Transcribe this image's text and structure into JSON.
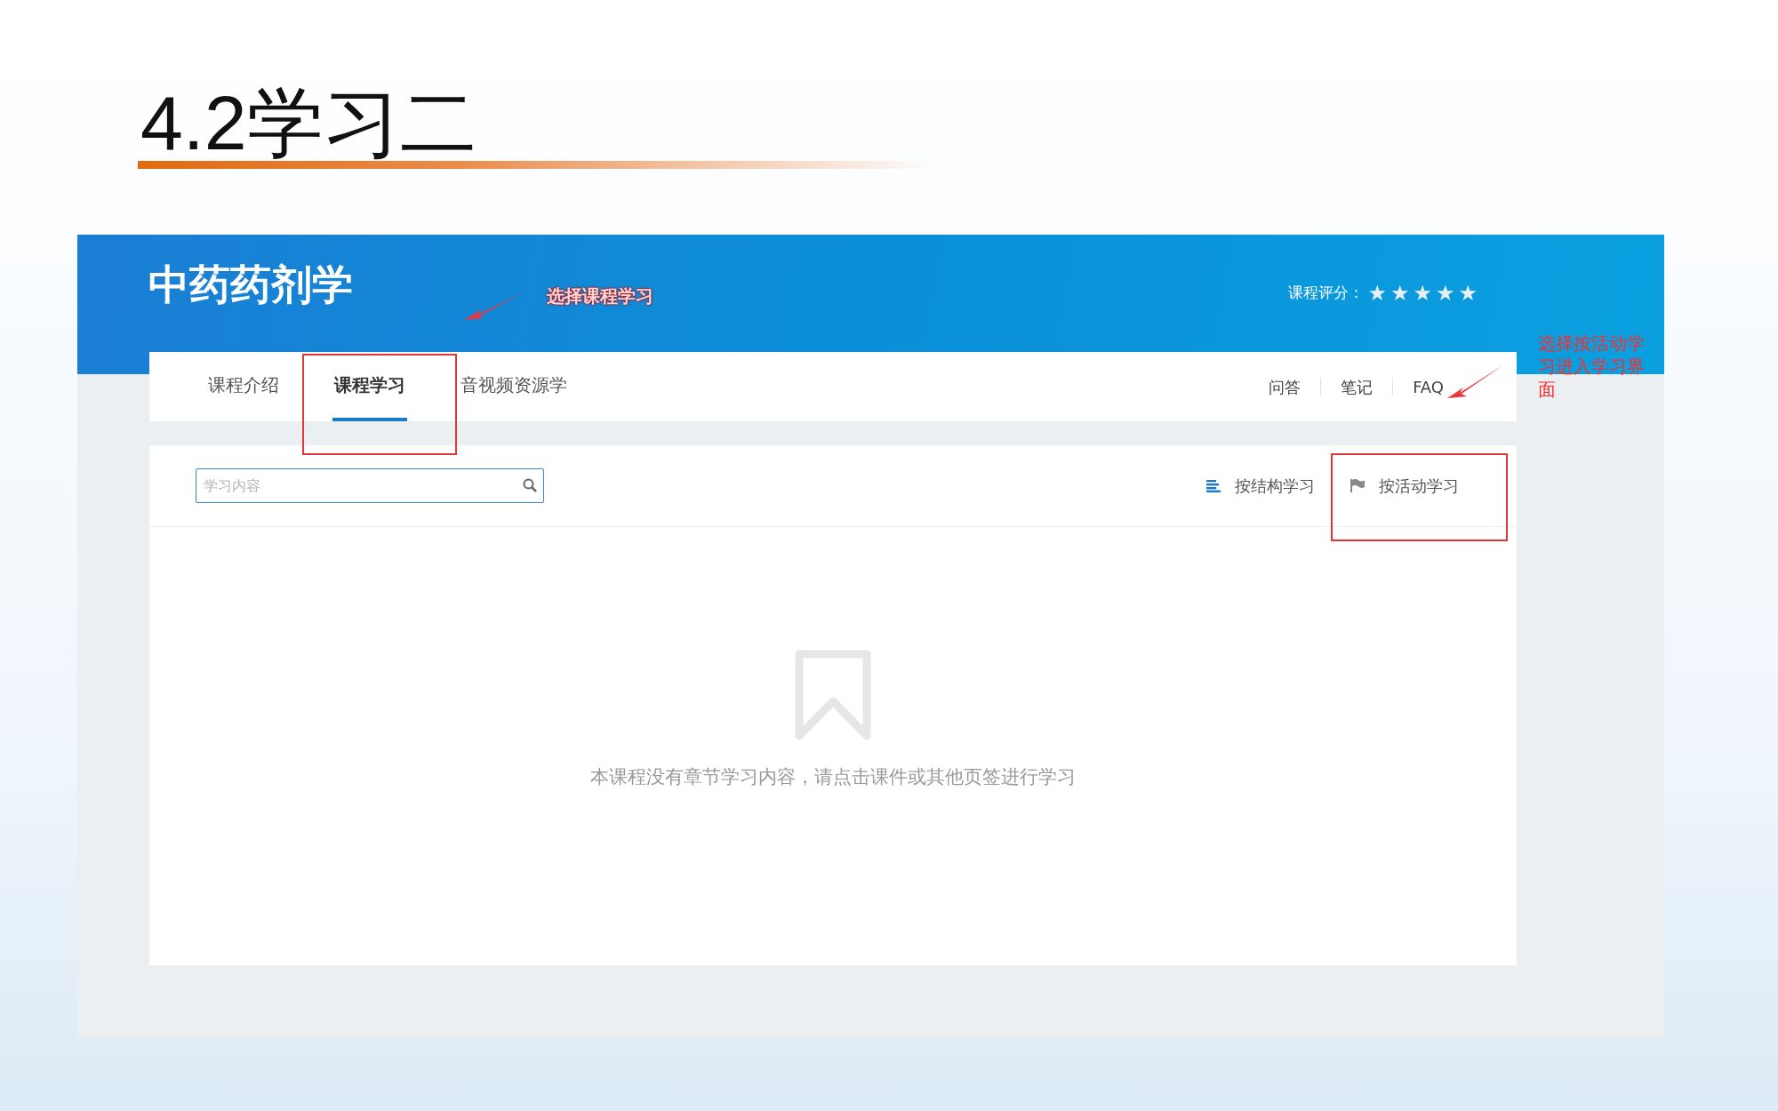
{
  "slide_title": "4.2学习二",
  "course": {
    "title": "中药药剂学",
    "rating_label": "课程评分：",
    "stars": 5
  },
  "tabs": [
    {
      "label": "课程介绍",
      "selected": false
    },
    {
      "label": "课程学习",
      "selected": true
    },
    {
      "label": "音视频资源学",
      "selected": false
    }
  ],
  "links": [
    "问答",
    "笔记",
    "FAQ"
  ],
  "search": {
    "placeholder": "学习内容"
  },
  "view_modes": [
    {
      "label": "按结构学习",
      "kind": "structure",
      "selected": true
    },
    {
      "label": "按活动学习",
      "kind": "activity",
      "selected": false
    }
  ],
  "empty_message": "本课程没有章节学习内容，请点击课件或其他页签进行学习",
  "annotations": [
    {
      "text": "选择课程学习"
    },
    {
      "text": "选择按活动学习进入学习界面"
    }
  ]
}
